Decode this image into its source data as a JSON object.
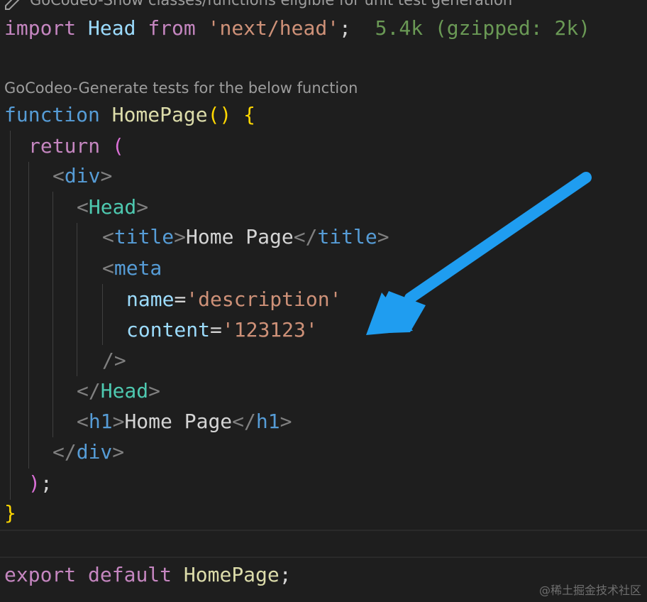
{
  "codelens": {
    "top_partial": "GoCodeo-Show classes/functions eligible for unit test generation",
    "generate_tests": "GoCodeo-Generate tests for the below function"
  },
  "code": {
    "import_kw": "import",
    "import_name": "Head",
    "from_kw": "from",
    "import_path": "'next/head'",
    "semicolon": ";",
    "import_size": "5.4k (gzipped: 2k)",
    "function_kw": "function",
    "function_name": "HomePage",
    "parens": "()",
    "open_brace": "{",
    "return_kw": "return",
    "open_paren": "(",
    "div_open": "div",
    "head_open": "Head",
    "title_tag": "title",
    "title_text": "Home Page",
    "meta_tag": "meta",
    "meta_name_attr": "name",
    "meta_name_value": "'description'",
    "meta_content_attr": "content",
    "meta_content_value": "'123123'",
    "self_close": "/>",
    "head_close": "Head",
    "h1_tag": "h1",
    "h1_text": "Home Page",
    "div_close": "div",
    "close_paren": ")",
    "close_semicolon": ";",
    "close_brace": "}",
    "export_kw": "export",
    "default_kw": "default",
    "export_name": "HomePage",
    "export_semicolon": ";"
  },
  "watermark": "@稀土掘金技术社区",
  "colors": {
    "background": "#1e1e1e",
    "arrow": "#1f9df0"
  }
}
